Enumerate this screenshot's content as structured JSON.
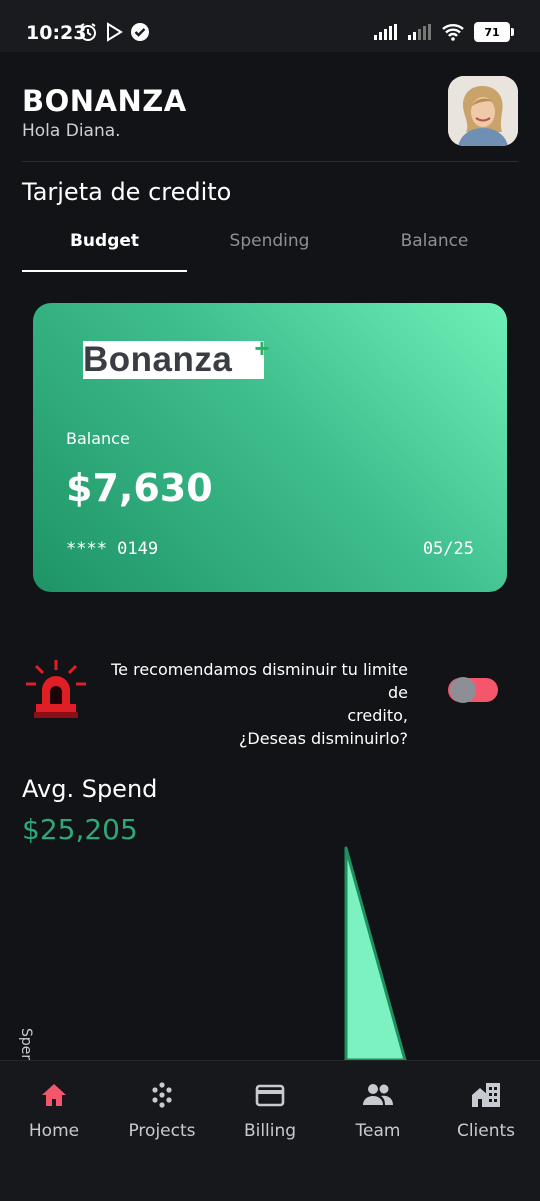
{
  "status_bar": {
    "time": "10:23",
    "battery": "71"
  },
  "header": {
    "app_title": "BONANZA",
    "greeting": "Hola Diana."
  },
  "section_title": "Tarjeta de credito",
  "tabs": [
    {
      "label": "Budget",
      "active": true
    },
    {
      "label": "Spending",
      "active": false
    },
    {
      "label": "Balance",
      "active": false
    }
  ],
  "card": {
    "brand": "Bonanza",
    "balance_label": "Balance",
    "balance": "$7,630",
    "number": "**** 0149",
    "expiry": "05/25"
  },
  "recommendation": {
    "line1": "Te recomendamos disminuir tu limite de",
    "line2": "credito,",
    "line3": "¿Deseas disminuirlo?",
    "toggle_on": false
  },
  "avg_spend": {
    "label": "Avg. Spend",
    "value": "$25,205",
    "color": "#2ea877"
  },
  "chart_data": {
    "type": "area",
    "ylabel": "Spend",
    "fill_color": "#7cf2c0",
    "stroke_color": "#1f8f5f"
  },
  "bottom_nav": [
    {
      "label": "Home",
      "icon": "home-icon",
      "active": true
    },
    {
      "label": "Projects",
      "icon": "grid-dots-icon",
      "active": false
    },
    {
      "label": "Billing",
      "icon": "credit-card-icon",
      "active": false
    },
    {
      "label": "Team",
      "icon": "people-icon",
      "active": false
    },
    {
      "label": "Clients",
      "icon": "buildings-icon",
      "active": false
    }
  ],
  "colors": {
    "accent": "#f4566b",
    "card_green": "#3fbe8d",
    "background": "#121316"
  }
}
